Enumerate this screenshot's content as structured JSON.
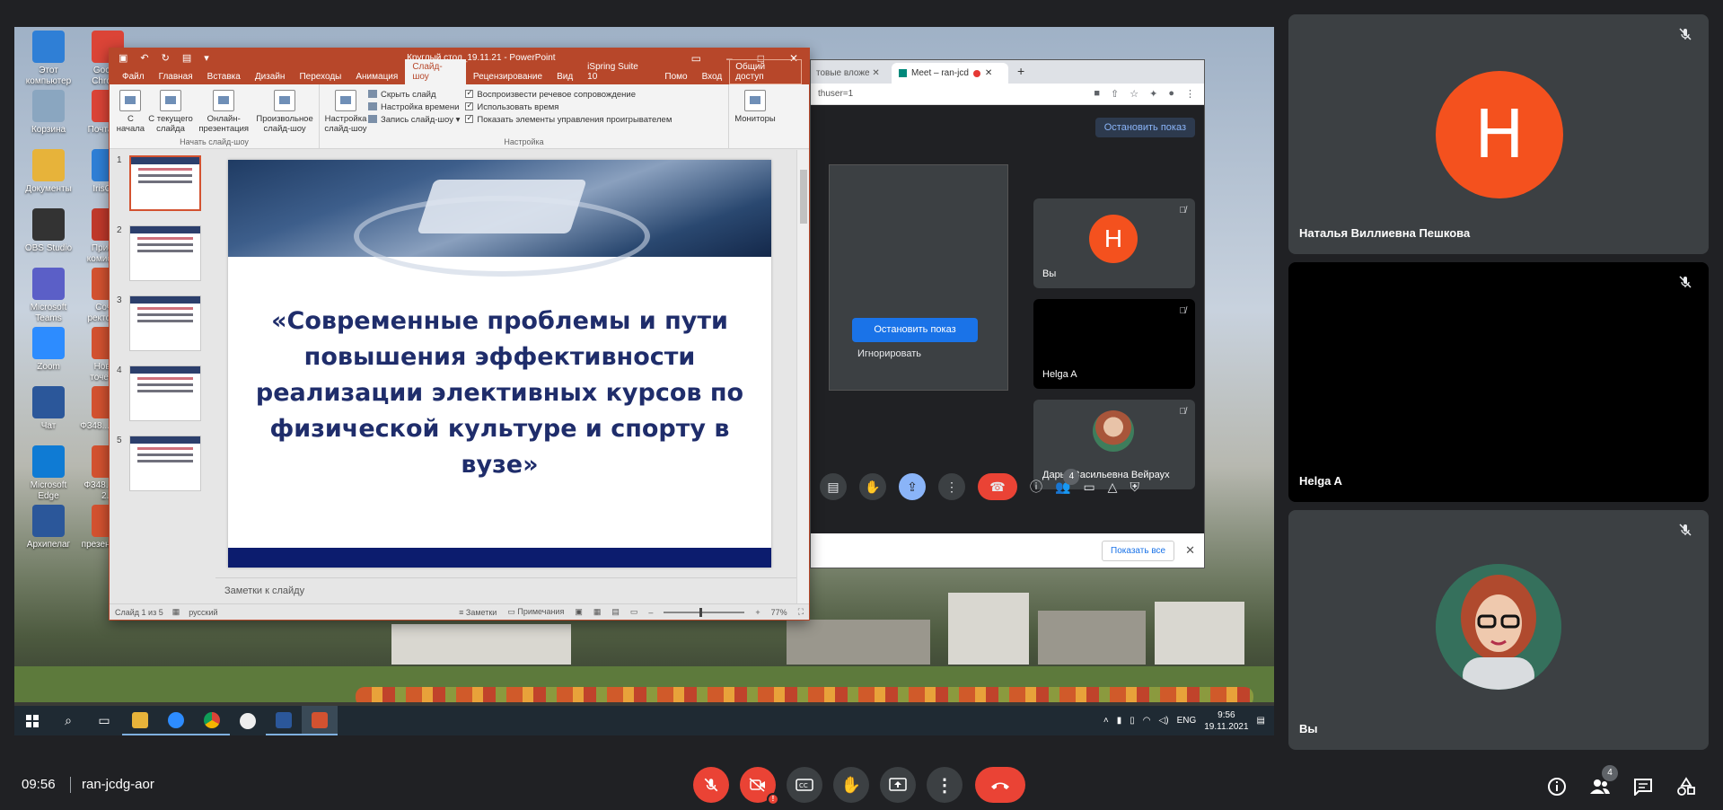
{
  "desktop": {
    "icons": [
      {
        "label": "Этот компьютер",
        "color": "#2f7fd6"
      },
      {
        "label": "Google Chrome",
        "color": "#db4437"
      },
      {
        "label": "Корзина",
        "color": "#8aa6c0"
      },
      {
        "label": "Почта К...",
        "color": "#db4437"
      },
      {
        "label": "Документы",
        "color": "#e7b33a"
      },
      {
        "label": "IrisCli...",
        "color": "#2f7fd6"
      },
      {
        "label": "OBS Studio",
        "color": "#333333"
      },
      {
        "label": "Приема комисси...",
        "color": "#c0392b"
      },
      {
        "label": "Microsoft Teams",
        "color": "#5b5fc7"
      },
      {
        "label": "Сочет ректора...",
        "color": "#d35230"
      },
      {
        "label": "Zoom",
        "color": "#2d8cff"
      },
      {
        "label": "Новый точечн...",
        "color": "#d35230"
      },
      {
        "label": "Чат",
        "color": "#2b579a"
      },
      {
        "label": "Ф348... Суд...",
        "color": "#d35230"
      },
      {
        "label": "Microsoft Edge",
        "color": "#0f7bd4"
      },
      {
        "label": "Ф348... Суд 2...",
        "color": "#d35230"
      },
      {
        "label": "Архипелаг",
        "color": "#2b579a"
      },
      {
        "label": "презентация",
        "color": "#d35230"
      }
    ],
    "tray": {
      "lang": "ENG",
      "time": "9:56",
      "date": "19.11.2021"
    }
  },
  "powerpoint": {
    "title": "Круглый стол_19.11.21 - PowerPoint",
    "menu": [
      "Файл",
      "Главная",
      "Вставка",
      "Дизайн",
      "Переходы",
      "Анимация",
      "Слайд-шоу",
      "Рецензирование",
      "Вид",
      "iSpring Suite 10",
      "Помо",
      "Вход"
    ],
    "active_tab": "Слайд-шоу",
    "share": "Общий доступ",
    "ribbon": {
      "start_group": "Начать слайд-шоу",
      "setup_group": "Настройка",
      "btn_from_start": "С начала",
      "btn_from_current": "С текущего слайда",
      "btn_online": "Онлайн-презентация",
      "btn_custom": "Произвольное слайд-шоу",
      "btn_setup": "Настройка слайд-шоу",
      "hide_slide": "Скрыть слайд",
      "rehearse": "Настройка времени",
      "record": "Запись слайд-шоу",
      "play_narrations": "Воспроизвести речевое сопровождение",
      "use_timings": "Использовать время",
      "show_controls": "Показать элементы управления проигрывателем",
      "monitors": "Мониторы"
    },
    "slide_numbers": [
      "1",
      "2",
      "3",
      "4",
      "5"
    ],
    "slide_title": "«Современные проблемы и пути повышения эффективности реализации элективных курсов по физической культуре и спорту в вузе»",
    "notes": "Заметки к слайду",
    "status": {
      "slide": "Слайд 1 из 5",
      "lang": "русский",
      "notes": "Заметки",
      "comments": "Примечания",
      "zoom": "77%"
    }
  },
  "chrome": {
    "tab0": "товые вложе",
    "tab1": "Meet – ran-jcd",
    "url": "thuser=1",
    "stop_top": "Остановить показ",
    "stop_btn": "Остановить показ",
    "ignore": "Игнорировать",
    "show_all": "Показать все",
    "participants_badge": "4",
    "mini_tiles": [
      {
        "name": "Вы",
        "initial": "H"
      },
      {
        "name": "Helga A"
      },
      {
        "name": "Дарья Васильевна Вейраух"
      }
    ]
  },
  "participants": [
    {
      "name": "Наталья Виллиевна Пешкова",
      "initial": "H",
      "avatar_color": "#f4511e"
    },
    {
      "name": "Helga A"
    },
    {
      "name": "Вы"
    }
  ],
  "meeting": {
    "time": "09:56",
    "code": "ran-jcdg-aor",
    "participants_count": "4",
    "accent_red": "#ea4335"
  }
}
